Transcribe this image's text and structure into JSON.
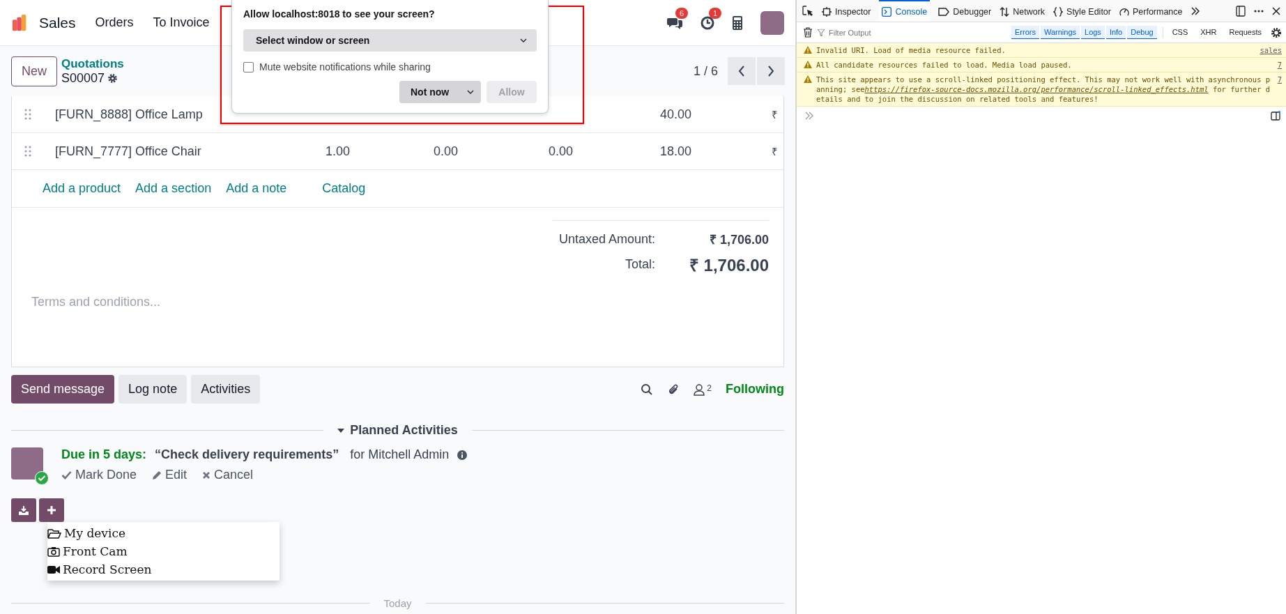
{
  "app": {
    "name": "Sales",
    "menu": [
      "Orders",
      "To Invoice"
    ],
    "badges": [
      "6",
      "1"
    ]
  },
  "control": {
    "new": "New",
    "breadcrumb": "Quotations",
    "record": "S00007",
    "pager": "1 / 6"
  },
  "lines": [
    {
      "product": "[FURN_8888] Office Lamp",
      "price": "40.00",
      "currency": "₹"
    },
    {
      "product": "[FURN_7777] Office Chair",
      "quantity": "1.00",
      "delivered": "0.00",
      "invoiced": "0.00",
      "price": "18.00",
      "currency": "₹"
    }
  ],
  "add_links": [
    "Add a product",
    "Add a section",
    "Add a note",
    "Catalog"
  ],
  "totals": {
    "untaxed_label": "Untaxed Amount:",
    "untaxed": "₹ 1,706.00",
    "total_label": "Total:",
    "total": "₹ 1,706.00"
  },
  "terms_placeholder": "Terms and conditions...",
  "chatter": {
    "buttons": [
      {
        "label": "Send message",
        "selected": true
      },
      {
        "label": "Log note",
        "selected": false
      },
      {
        "label": "Activities",
        "selected": false
      }
    ],
    "followers": "2",
    "following": "Following"
  },
  "planned": {
    "title": "Planned Activities",
    "due": "Due in 5 days:",
    "summary": "“Check delivery requirements”",
    "assignee": "for Mitchell Admin",
    "done": true,
    "actions": [
      {
        "kind": "done",
        "label": "Mark Done"
      },
      {
        "kind": "edit",
        "label": "Edit"
      },
      {
        "kind": "cancel",
        "label": "Cancel"
      }
    ]
  },
  "upload_menu": [
    {
      "kind": "folder",
      "label": "My device"
    },
    {
      "kind": "camera",
      "label": "Front Cam"
    },
    {
      "kind": "video",
      "label": "Record Screen"
    }
  ],
  "today": "Today",
  "share_prompt": {
    "title": "Allow localhost:8018 to see your screen?",
    "select": "Select window or screen",
    "mute": {
      "label": "Mute website notifications while sharing",
      "checked": false
    },
    "not_now": "Not now",
    "allow": "Allow",
    "allow_disabled": true
  },
  "devtools": {
    "tabs": [
      {
        "label": "Inspector",
        "kind": "inspector",
        "selected": false
      },
      {
        "label": "Console",
        "kind": "console",
        "selected": true
      },
      {
        "label": "Debugger",
        "kind": "debugger",
        "selected": false
      },
      {
        "label": "Network",
        "kind": "network",
        "selected": false
      },
      {
        "label": "Style Editor",
        "kind": "style",
        "selected": false
      },
      {
        "label": "Performance",
        "kind": "performance",
        "selected": false
      }
    ],
    "filter_placeholder": "Filter Output",
    "levels": [
      {
        "label": "Errors",
        "selected": true
      },
      {
        "label": "Warnings",
        "selected": true
      },
      {
        "label": "Logs",
        "selected": true
      },
      {
        "label": "Info",
        "selected": true
      },
      {
        "label": "Debug",
        "selected": true
      }
    ],
    "types": [
      {
        "label": "CSS",
        "selected": false
      },
      {
        "label": "XHR",
        "selected": false
      },
      {
        "label": "Requests",
        "selected": false
      }
    ],
    "messages": [
      {
        "text": "Invalid URI. Load of media resource  failed.",
        "source": "sales"
      },
      {
        "text": "All candidate resources failed to load. Media load paused.",
        "source": "7"
      },
      {
        "text": "This site appears to use a scroll-linked positioning effect. This may not work well with asynchronous panning; see",
        "link": "https://firefox-source-docs.mozilla.org/performance/scroll-linked_effects.html",
        "after": "for further details and to join the discussion on related tools and features!",
        "source": "7"
      }
    ]
  }
}
